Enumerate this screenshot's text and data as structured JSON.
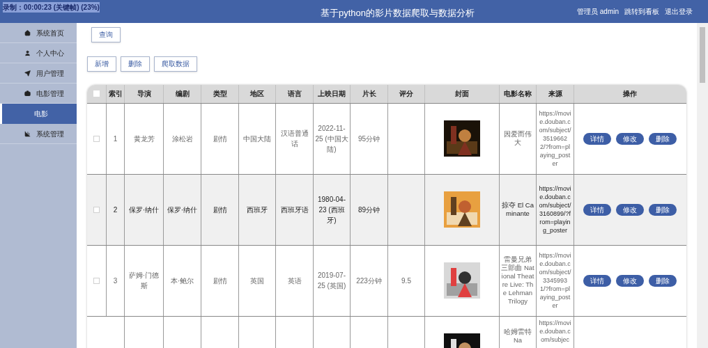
{
  "recorder_overlay": "录制：00:00:23 (关键帧) (23%)",
  "header": {
    "title": "基于python的影片数据爬取与数据分析",
    "user": "管理员 admin",
    "links": [
      "跳转到看板",
      "退出登录"
    ]
  },
  "sidebar": {
    "items": [
      {
        "label": "系统首页",
        "selected": false
      },
      {
        "label": "个人中心",
        "selected": false
      },
      {
        "label": "用户管理",
        "selected": false
      },
      {
        "label": "电影管理",
        "selected": false,
        "children": [
          {
            "label": "电影",
            "selected": true
          }
        ]
      },
      {
        "label": "系统管理",
        "selected": false
      }
    ]
  },
  "search_button": "查询",
  "toolbar": [
    "新增",
    "删除",
    "爬取数据"
  ],
  "table": {
    "header_checkbox": {
      "checked": false
    },
    "columns": [
      "索引",
      "导演",
      "编剧",
      "类型",
      "地区",
      "语言",
      "上映日期",
      "片长",
      "评分",
      "封面",
      "电影名称",
      "来源",
      "操作"
    ],
    "rows": [
      {
        "checked": false,
        "hovered": false,
        "cells": [
          "1",
          "黄龙芳",
          "涂松岩",
          "剧情",
          "中国大陆",
          "汉语普通话",
          "2022-11-25 (中国大陆)",
          "95分钟",
          ""
        ],
        "cover": {
          "kind": "picture"
        },
        "name": "因爱而伟大",
        "source": "https://movie.douban.com/subject/35196622/?from=playing_poster",
        "actions": [
          "详情",
          "修改",
          "删除"
        ]
      },
      {
        "checked": false,
        "hovered": true,
        "cells": [
          "2",
          "保罗·纳什",
          "保罗·纳什",
          "剧情",
          "西班牙",
          "西班牙语",
          "1980-04-23 (西班牙)",
          "89分钟",
          ""
        ],
        "cover": {
          "kind": "picture"
        },
        "name": "掠夺 El Caminante",
        "source": "https://movie.douban.com/subject/3160899/?from=playing_poster",
        "actions": [
          "详情",
          "修改",
          "删除"
        ]
      },
      {
        "checked": false,
        "hovered": false,
        "cells": [
          "3",
          "萨姆·门德斯",
          "本·鲍尔",
          "剧情",
          "英国",
          "英语",
          "2019-07-25 (英国)",
          "223分钟",
          "9.5"
        ],
        "cover": {
          "kind": "picture"
        },
        "name": "雷曼兄弟三部曲 National Theatre Live: The Lehman Trilogy",
        "source": "https://movie.douban.com/subject/33459931/?from=playing_poster",
        "actions": [
          "详情",
          "修改",
          "删除"
        ]
      },
      {
        "hovered": false,
        "cells": [
          "",
          "",
          "",
          "",
          "",
          "",
          "",
          "",
          ""
        ],
        "cover": {
          "kind": "picture"
        },
        "name": "哈姆雷特 Na",
        "source": "https://movie.douban.com/subjec"
      }
    ]
  }
}
